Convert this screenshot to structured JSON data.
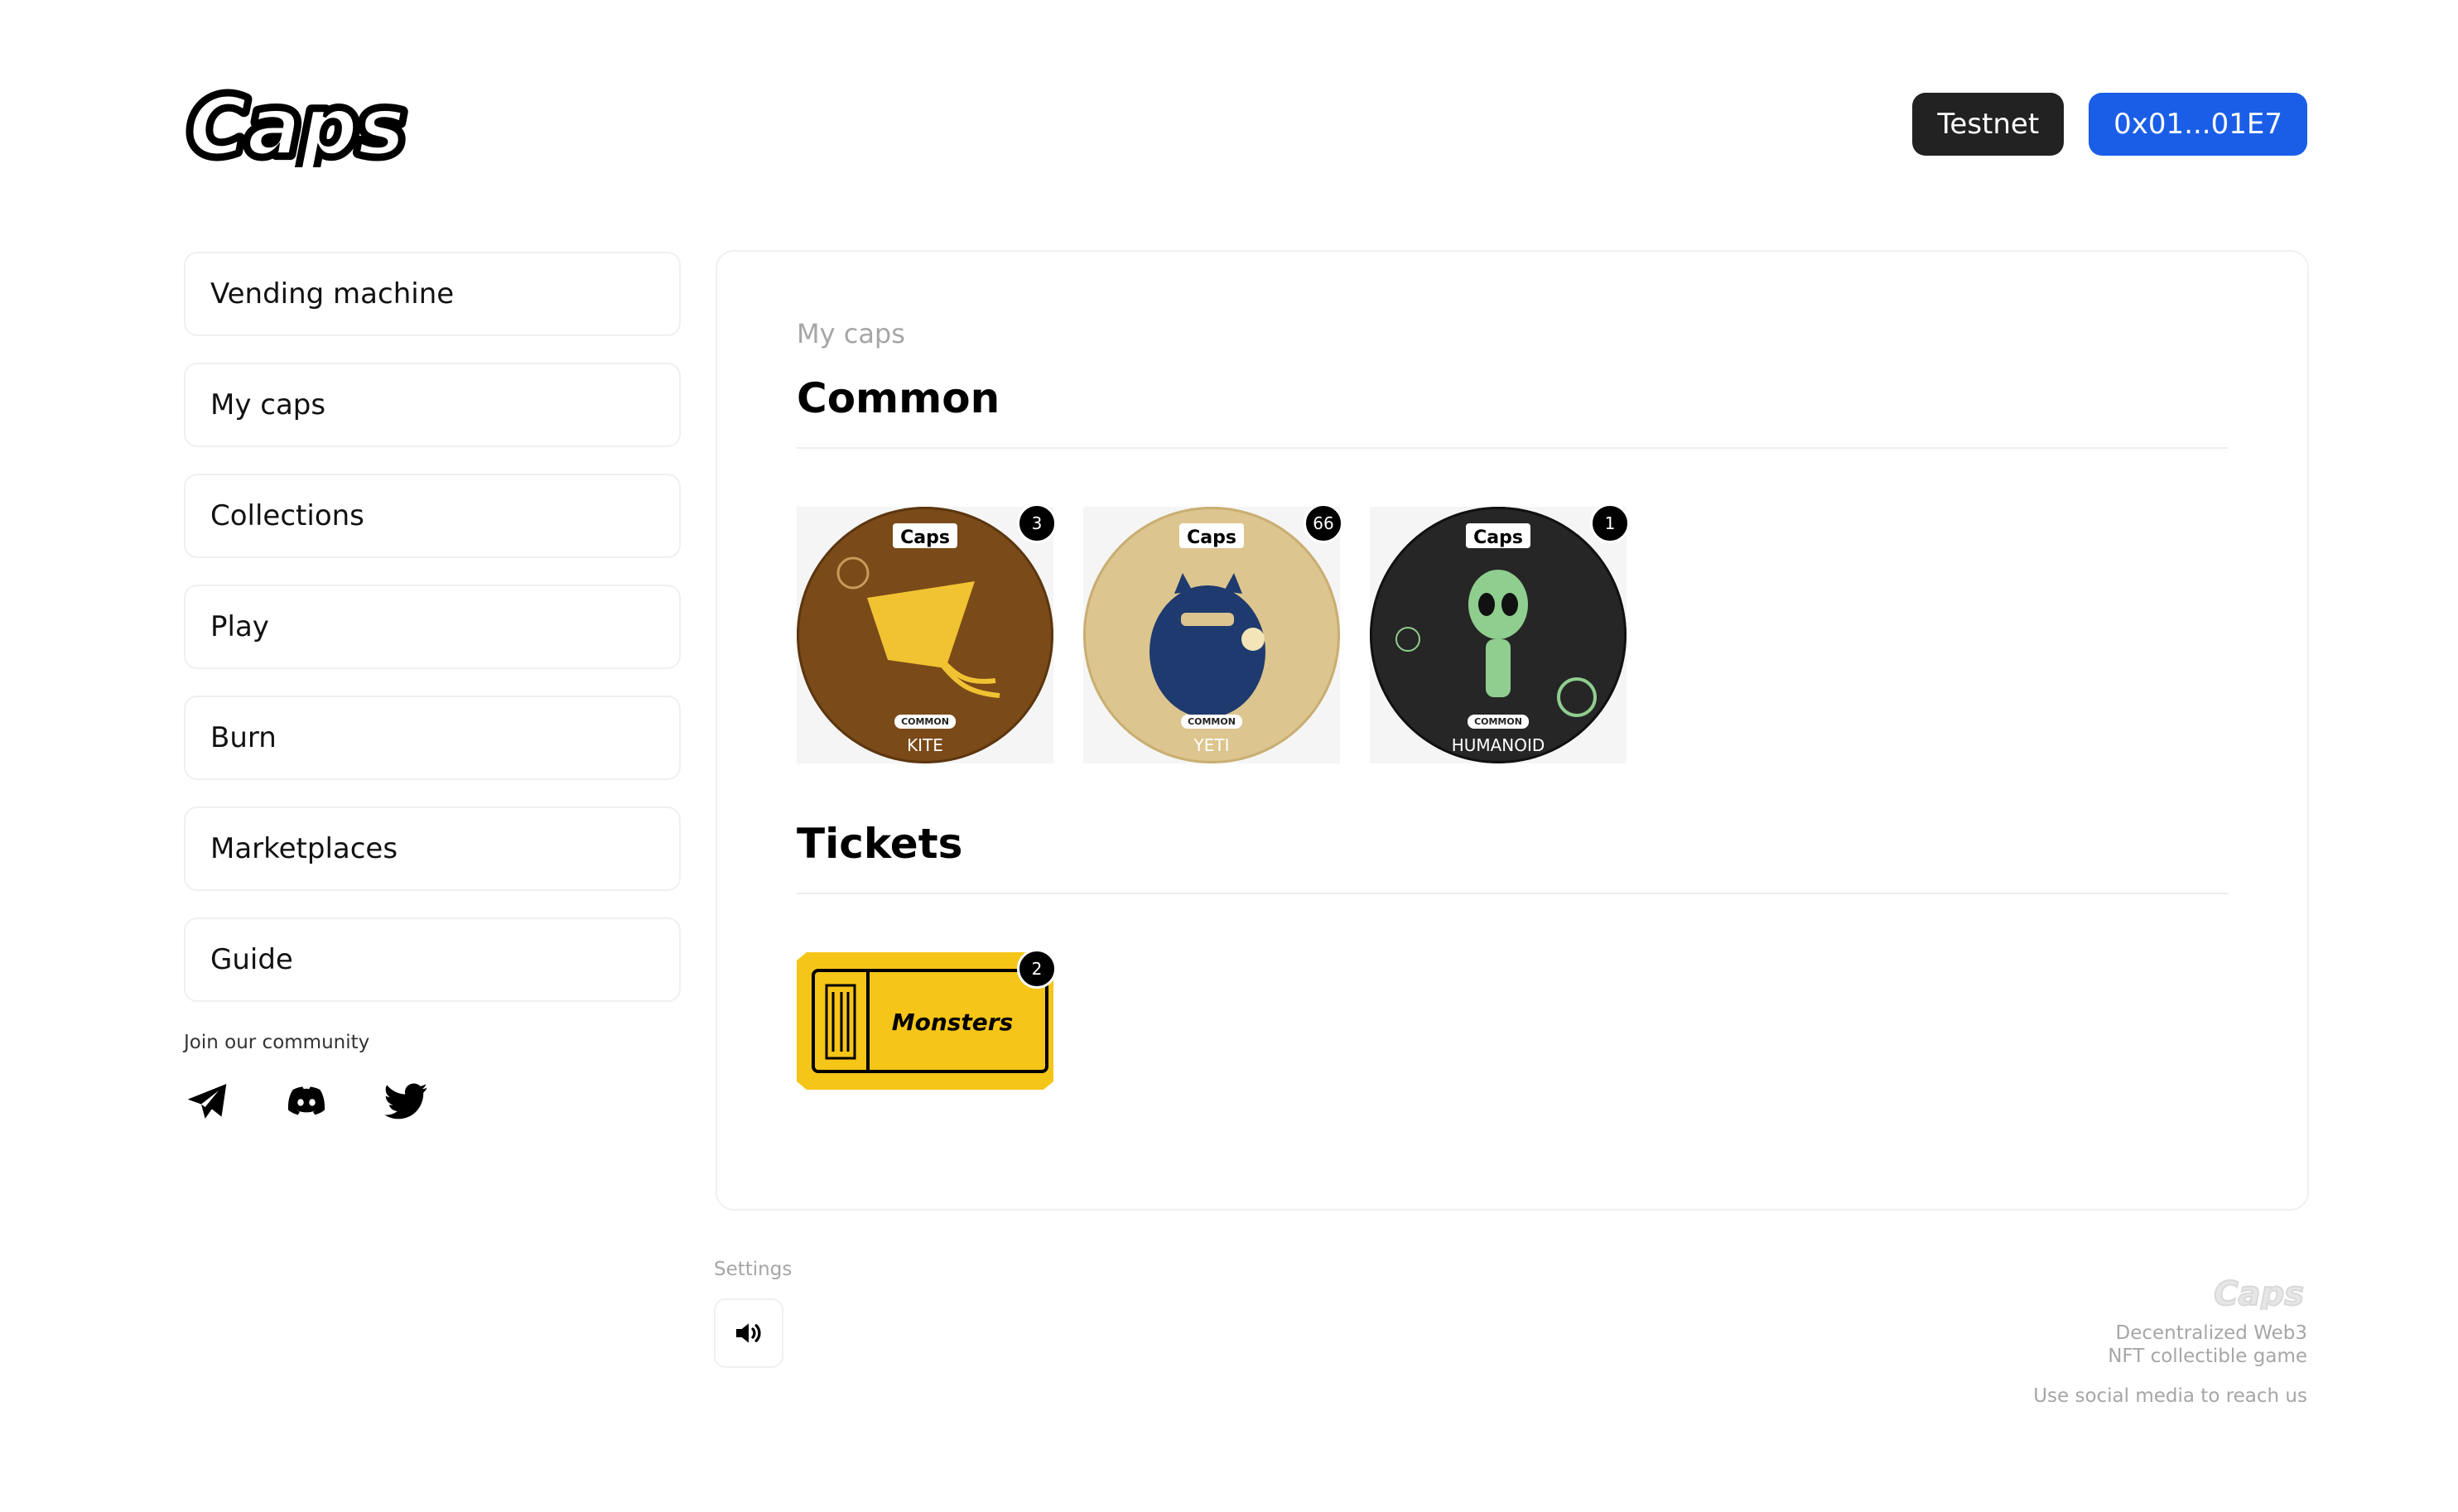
{
  "header": {
    "logo_text": "Caps",
    "network_label": "Testnet",
    "wallet_label": "0x01...01E7"
  },
  "sidebar": {
    "items": [
      {
        "label": "Vending machine"
      },
      {
        "label": "My caps"
      },
      {
        "label": "Collections"
      },
      {
        "label": "Play"
      },
      {
        "label": "Burn"
      },
      {
        "label": "Marketplaces"
      },
      {
        "label": "Guide"
      }
    ],
    "community_label": "Join our community",
    "socials": [
      "telegram-icon",
      "discord-icon",
      "twitter-icon"
    ]
  },
  "main": {
    "breadcrumb": "My caps",
    "common": {
      "title": "Common",
      "caps": [
        {
          "name": "KITE",
          "rarity": "COMMON",
          "count": "3",
          "color": "#7a4a18",
          "art_color": "#f1c232"
        },
        {
          "name": "YETI",
          "rarity": "COMMON",
          "count": "66",
          "color": "#dcc58f",
          "art_color": "#1e3a6e"
        },
        {
          "name": "HUMANOID",
          "rarity": "COMMON",
          "count": "1",
          "color": "#262626",
          "art_color": "#8fce8f"
        }
      ]
    },
    "tickets": {
      "title": "Tickets",
      "items": [
        {
          "name": "Monsters",
          "count": "2",
          "color": "#f5c518"
        }
      ]
    }
  },
  "settings": {
    "label": "Settings",
    "sound_icon": "speaker-icon"
  },
  "footer": {
    "logo_text": "Caps",
    "tagline_1": "Decentralized Web3",
    "tagline_2": "NFT collectible game",
    "reach": "Use social media to reach us"
  },
  "colors": {
    "accent": "#1a5ee8",
    "dark": "#222222"
  }
}
